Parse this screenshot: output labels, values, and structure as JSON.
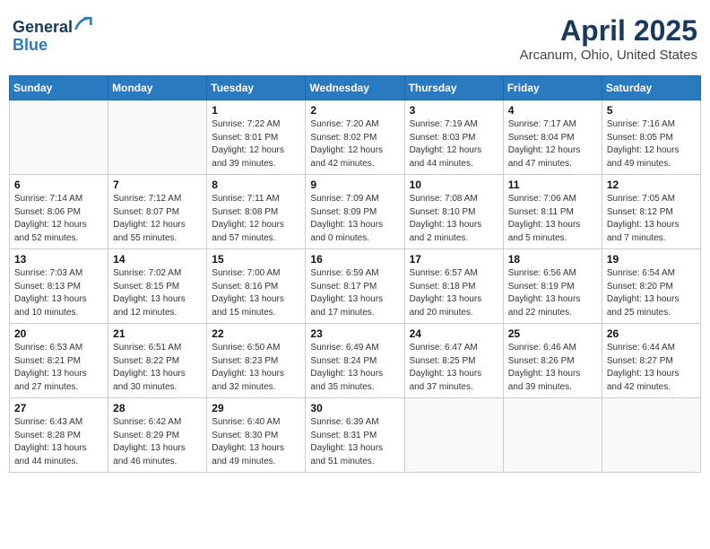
{
  "header": {
    "logo_line1": "General",
    "logo_line2": "Blue",
    "main_title": "April 2025",
    "subtitle": "Arcanum, Ohio, United States"
  },
  "calendar": {
    "days_of_week": [
      "Sunday",
      "Monday",
      "Tuesday",
      "Wednesday",
      "Thursday",
      "Friday",
      "Saturday"
    ],
    "weeks": [
      [
        {
          "day": "",
          "info": ""
        },
        {
          "day": "",
          "info": ""
        },
        {
          "day": "1",
          "info": "Sunrise: 7:22 AM\nSunset: 8:01 PM\nDaylight: 12 hours and 39 minutes."
        },
        {
          "day": "2",
          "info": "Sunrise: 7:20 AM\nSunset: 8:02 PM\nDaylight: 12 hours and 42 minutes."
        },
        {
          "day": "3",
          "info": "Sunrise: 7:19 AM\nSunset: 8:03 PM\nDaylight: 12 hours and 44 minutes."
        },
        {
          "day": "4",
          "info": "Sunrise: 7:17 AM\nSunset: 8:04 PM\nDaylight: 12 hours and 47 minutes."
        },
        {
          "day": "5",
          "info": "Sunrise: 7:16 AM\nSunset: 8:05 PM\nDaylight: 12 hours and 49 minutes."
        }
      ],
      [
        {
          "day": "6",
          "info": "Sunrise: 7:14 AM\nSunset: 8:06 PM\nDaylight: 12 hours and 52 minutes."
        },
        {
          "day": "7",
          "info": "Sunrise: 7:12 AM\nSunset: 8:07 PM\nDaylight: 12 hours and 55 minutes."
        },
        {
          "day": "8",
          "info": "Sunrise: 7:11 AM\nSunset: 8:08 PM\nDaylight: 12 hours and 57 minutes."
        },
        {
          "day": "9",
          "info": "Sunrise: 7:09 AM\nSunset: 8:09 PM\nDaylight: 13 hours and 0 minutes."
        },
        {
          "day": "10",
          "info": "Sunrise: 7:08 AM\nSunset: 8:10 PM\nDaylight: 13 hours and 2 minutes."
        },
        {
          "day": "11",
          "info": "Sunrise: 7:06 AM\nSunset: 8:11 PM\nDaylight: 13 hours and 5 minutes."
        },
        {
          "day": "12",
          "info": "Sunrise: 7:05 AM\nSunset: 8:12 PM\nDaylight: 13 hours and 7 minutes."
        }
      ],
      [
        {
          "day": "13",
          "info": "Sunrise: 7:03 AM\nSunset: 8:13 PM\nDaylight: 13 hours and 10 minutes."
        },
        {
          "day": "14",
          "info": "Sunrise: 7:02 AM\nSunset: 8:15 PM\nDaylight: 13 hours and 12 minutes."
        },
        {
          "day": "15",
          "info": "Sunrise: 7:00 AM\nSunset: 8:16 PM\nDaylight: 13 hours and 15 minutes."
        },
        {
          "day": "16",
          "info": "Sunrise: 6:59 AM\nSunset: 8:17 PM\nDaylight: 13 hours and 17 minutes."
        },
        {
          "day": "17",
          "info": "Sunrise: 6:57 AM\nSunset: 8:18 PM\nDaylight: 13 hours and 20 minutes."
        },
        {
          "day": "18",
          "info": "Sunrise: 6:56 AM\nSunset: 8:19 PM\nDaylight: 13 hours and 22 minutes."
        },
        {
          "day": "19",
          "info": "Sunrise: 6:54 AM\nSunset: 8:20 PM\nDaylight: 13 hours and 25 minutes."
        }
      ],
      [
        {
          "day": "20",
          "info": "Sunrise: 6:53 AM\nSunset: 8:21 PM\nDaylight: 13 hours and 27 minutes."
        },
        {
          "day": "21",
          "info": "Sunrise: 6:51 AM\nSunset: 8:22 PM\nDaylight: 13 hours and 30 minutes."
        },
        {
          "day": "22",
          "info": "Sunrise: 6:50 AM\nSunset: 8:23 PM\nDaylight: 13 hours and 32 minutes."
        },
        {
          "day": "23",
          "info": "Sunrise: 6:49 AM\nSunset: 8:24 PM\nDaylight: 13 hours and 35 minutes."
        },
        {
          "day": "24",
          "info": "Sunrise: 6:47 AM\nSunset: 8:25 PM\nDaylight: 13 hours and 37 minutes."
        },
        {
          "day": "25",
          "info": "Sunrise: 6:46 AM\nSunset: 8:26 PM\nDaylight: 13 hours and 39 minutes."
        },
        {
          "day": "26",
          "info": "Sunrise: 6:44 AM\nSunset: 8:27 PM\nDaylight: 13 hours and 42 minutes."
        }
      ],
      [
        {
          "day": "27",
          "info": "Sunrise: 6:43 AM\nSunset: 8:28 PM\nDaylight: 13 hours and 44 minutes."
        },
        {
          "day": "28",
          "info": "Sunrise: 6:42 AM\nSunset: 8:29 PM\nDaylight: 13 hours and 46 minutes."
        },
        {
          "day": "29",
          "info": "Sunrise: 6:40 AM\nSunset: 8:30 PM\nDaylight: 13 hours and 49 minutes."
        },
        {
          "day": "30",
          "info": "Sunrise: 6:39 AM\nSunset: 8:31 PM\nDaylight: 13 hours and 51 minutes."
        },
        {
          "day": "",
          "info": ""
        },
        {
          "day": "",
          "info": ""
        },
        {
          "day": "",
          "info": ""
        }
      ]
    ]
  }
}
